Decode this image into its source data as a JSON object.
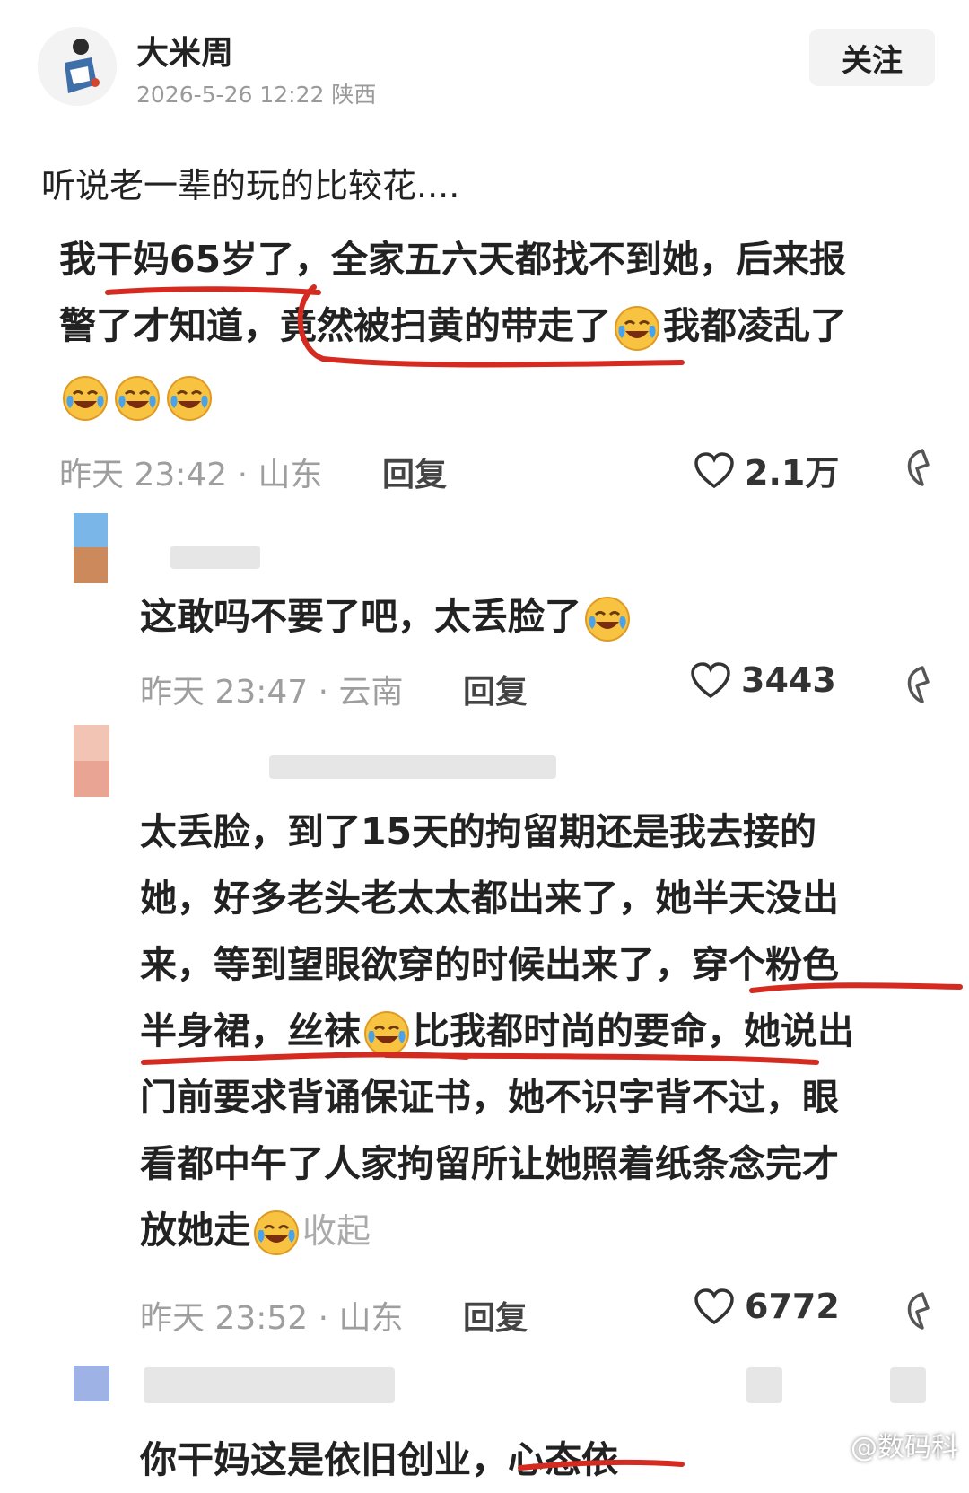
{
  "post": {
    "author": "大米周",
    "meta": "2026-5-26 12:22 陕西",
    "follow_label": "关注",
    "text": "听说老一辈的玩的比较花...."
  },
  "comments": [
    {
      "line1": "我干妈65岁了，全家五六天都找不到她，后来报",
      "line2a": "警了才知道，竟然被扫黄的带走了",
      "line2b": "我都凌乱了",
      "meta": "昨天 23:42 · 山东",
      "reply": "回复",
      "likes": "2.1万"
    },
    {
      "text": "这敢吗不要了吧，太丢脸了",
      "meta": "昨天 23:47 · 云南",
      "reply": "回复",
      "likes": "3443"
    },
    {
      "lines": [
        "太丢脸，到了15天的拘留期还是我去接的",
        "她，好多老头老太太都出来了，她半天没出",
        "来，等到望眼欲穿的时候出来了，穿个粉色"
      ],
      "line4a": "半身裙，丝袜",
      "line4b": "比我都时尚的要命，她说出",
      "line5": "门前要求背诵保证书，她不识字背不过，眼",
      "line6": "看都中午了人家拘留所让她照着纸条念完才",
      "line7": "放她走",
      "expand": "收起",
      "meta": "昨天 23:52 · 山东",
      "reply": "回复",
      "likes": "6772"
    },
    {
      "partial": "你干妈这是依旧创业，心态依"
    }
  ],
  "watermark": "@数码科",
  "colors": {
    "underline": "#d42a1f",
    "emoji_face": "#f7c341",
    "emoji_tear": "#4aa3e8"
  },
  "icons": [
    "heart-icon",
    "dislike-icon",
    "laugh-cry-emoji"
  ]
}
